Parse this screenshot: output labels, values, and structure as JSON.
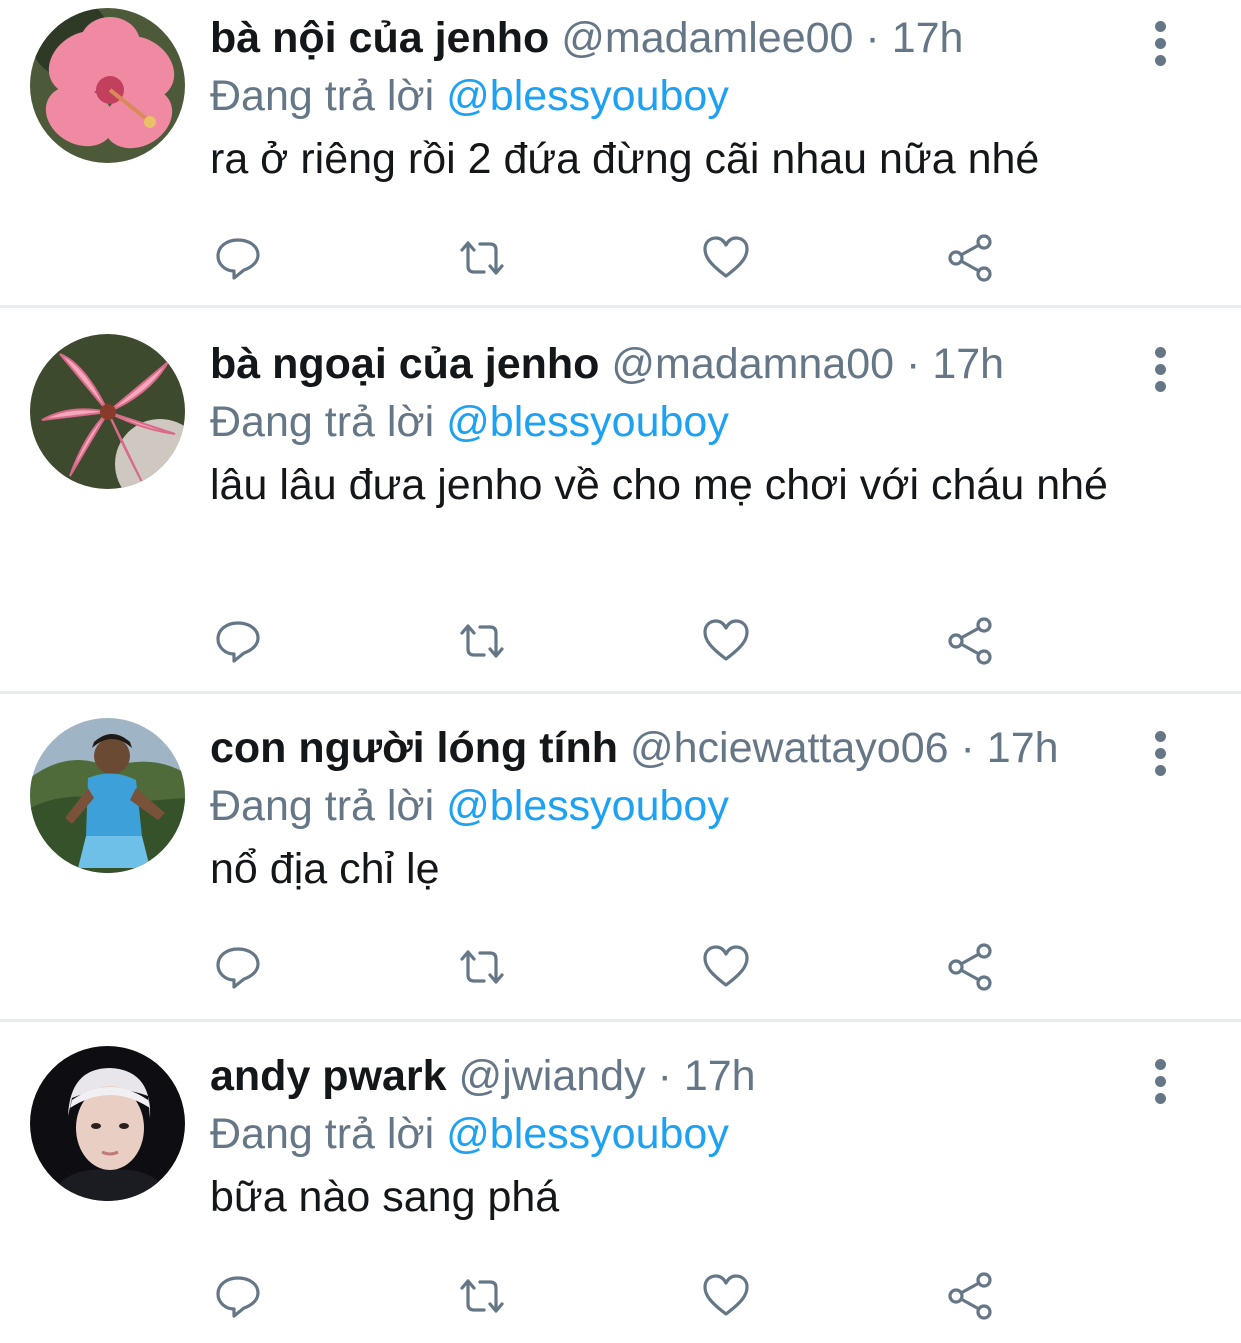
{
  "reply_prefix": "Đang trả lời",
  "tweets": [
    {
      "name": "bà nội của jenho",
      "handle": "@madamlee00",
      "separator": "·",
      "time": "17h",
      "reply_to": "@blessyouboy",
      "text": "ra ở riêng rồi 2 đứa đừng cãi nhau nữa nhé"
    },
    {
      "name": "bà ngoại của jenho",
      "handle": "@madamna00",
      "separator": "·",
      "time": "17h",
      "reply_to": "@blessyouboy",
      "text": "lâu lâu đưa jenho về cho mẹ chơi với cháu nhé"
    },
    {
      "name": "con người lóng tính",
      "handle": "@hciewattayo06",
      "separator": "·",
      "time": "17h",
      "reply_to": "@blessyouboy",
      "text": "nổ địa chỉ lẹ"
    },
    {
      "name": "andy pwark",
      "handle": "@jwiandy",
      "separator": "·",
      "time": "17h",
      "reply_to": "@blessyouboy",
      "text": "bữa nào sang phá"
    }
  ],
  "colors": {
    "link": "#1da1f2",
    "muted": "#657786",
    "text": "#14171a",
    "divider": "#e6ecf0"
  },
  "icons": [
    "reply-icon",
    "retweet-icon",
    "like-icon",
    "share-icon",
    "more-options-icon"
  ]
}
